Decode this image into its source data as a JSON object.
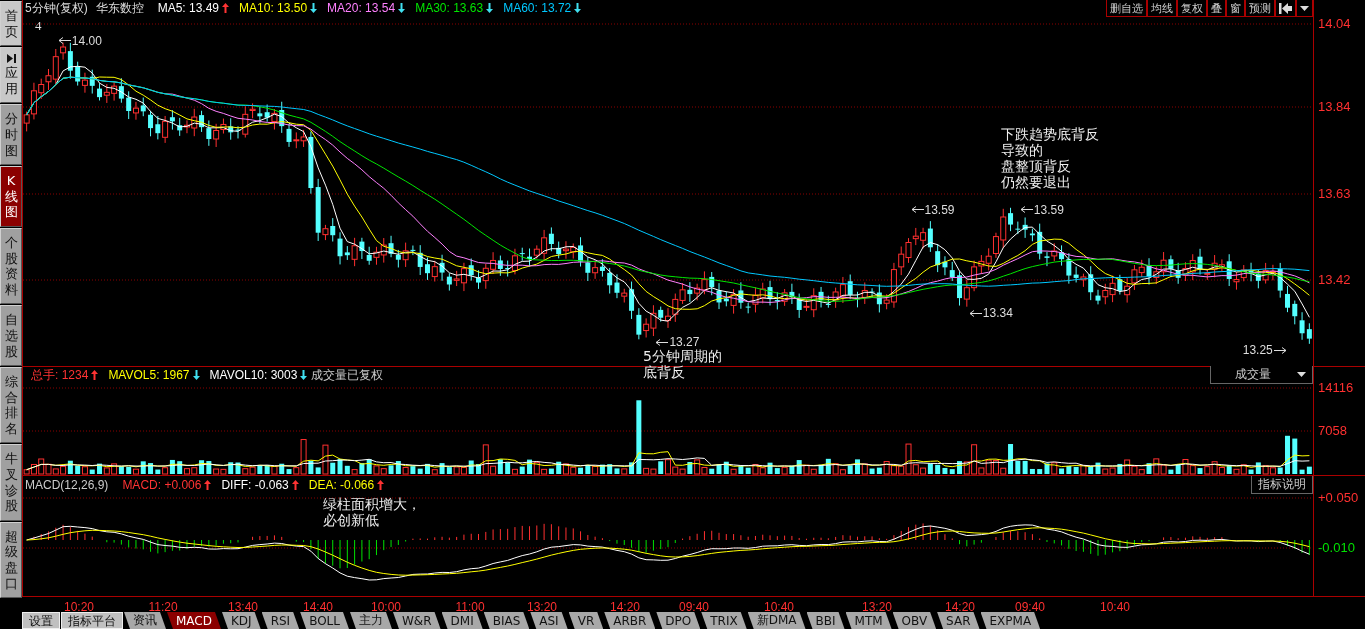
{
  "sidebar": {
    "items": [
      {
        "label": "首页",
        "icon": false,
        "selected": false
      },
      {
        "label": "应用",
        "icon": true,
        "selected": false
      },
      {
        "label": "分时图",
        "icon": false,
        "selected": false
      },
      {
        "label": "K线图",
        "icon": false,
        "selected": true
      },
      {
        "label": "个股资料",
        "icon": false,
        "selected": false
      },
      {
        "label": "自选股",
        "icon": false,
        "selected": false
      },
      {
        "label": "综合排名",
        "icon": false,
        "selected": false
      },
      {
        "label": "牛叉诊股",
        "icon": false,
        "selected": false
      },
      {
        "label": "超级盘口",
        "icon": false,
        "selected": false
      }
    ]
  },
  "price_panel": {
    "period": "5分钟(复权)",
    "stock": "华东数控",
    "legend": [
      {
        "label": "MA5: 13.49",
        "rising": true,
        "color": "#ffffff"
      },
      {
        "label": "MA10: 13.50",
        "rising": false,
        "color": "#ffff00"
      },
      {
        "label": "MA20: 13.54",
        "rising": false,
        "color": "#ff80ff"
      },
      {
        "label": "MA30: 13.63",
        "rising": false,
        "color": "#00e600"
      },
      {
        "label": "MA60: 13.72",
        "rising": false,
        "color": "#00c8ff"
      }
    ],
    "toolbar": [
      "删自选",
      "均线",
      "复权",
      "叠",
      "窗",
      "预测"
    ],
    "axis_labels": [
      "14.04",
      "13.84",
      "13.63",
      "13.42"
    ],
    "corner_mark": "4",
    "price_marks": [
      {
        "text": "14.00",
        "pointer_after": false
      },
      {
        "text": "13.27",
        "pointer_after": false
      },
      {
        "text": "13.59",
        "pointer_after": false
      },
      {
        "text": "13.34",
        "pointer_after": false
      },
      {
        "text": "13.59",
        "pointer_after": false
      },
      {
        "text": "13.25",
        "pointer_after": true
      }
    ],
    "notes": [
      {
        "lines": [
          "5分钟周期的",
          "底背反"
        ]
      },
      {
        "lines": [
          "下跌趋势底背反",
          "导致的",
          "盘整顶背反",
          "仍然要退出"
        ]
      }
    ]
  },
  "volume_panel": {
    "legend": [
      {
        "label": "总手: 1234",
        "rising": true,
        "color": "#ff3333"
      },
      {
        "label": "MAVOL5: 1967",
        "rising": false,
        "color": "#ffff00"
      },
      {
        "label": "MAVOL10: 3003",
        "rising": false,
        "color": "#ffffff"
      }
    ],
    "note": "成交量已复权",
    "selector": "成交量",
    "axis_labels": [
      "14116",
      "7058"
    ]
  },
  "macd_panel": {
    "title": "MACD(12,26,9)",
    "legend": [
      {
        "label": "MACD: +0.006",
        "rising": true,
        "color": "#ff3333"
      },
      {
        "label": "DIFF: -0.063",
        "rising": true,
        "color": "#ffffff"
      },
      {
        "label": "DEA: -0.066",
        "rising": true,
        "color": "#ffff00"
      }
    ],
    "help_button": "指标说明",
    "axis_labels": [
      "+0.050",
      "-0.010"
    ],
    "notes": [
      {
        "lines": [
          "绿柱面积增大，",
          "必创新低"
        ]
      }
    ]
  },
  "time_axis": [
    "10:20",
    "11:20",
    "13:40",
    "14:40",
    "10:00",
    "11:00",
    "13:20",
    "14:20",
    "09:40",
    "10:40",
    "13:20",
    "14:20",
    "09:40",
    "10:40"
  ],
  "bottom_tabs": [
    {
      "label": "设置",
      "kind": "button",
      "selected": false
    },
    {
      "label": "指标平台",
      "kind": "button",
      "selected": false
    },
    {
      "label": "资讯",
      "kind": "tab",
      "selected": false
    },
    {
      "label": "MACD",
      "kind": "tab",
      "selected": true
    },
    {
      "label": "KDJ",
      "kind": "tab",
      "selected": false
    },
    {
      "label": "RSI",
      "kind": "tab",
      "selected": false
    },
    {
      "label": "BOLL",
      "kind": "tab",
      "selected": false
    },
    {
      "label": "主力",
      "kind": "tab",
      "selected": false
    },
    {
      "label": "W&R",
      "kind": "tab",
      "selected": false
    },
    {
      "label": "DMI",
      "kind": "tab",
      "selected": false
    },
    {
      "label": "BIAS",
      "kind": "tab",
      "selected": false
    },
    {
      "label": "ASI",
      "kind": "tab",
      "selected": false
    },
    {
      "label": "VR",
      "kind": "tab",
      "selected": false
    },
    {
      "label": "ARBR",
      "kind": "tab",
      "selected": false
    },
    {
      "label": "DPO",
      "kind": "tab",
      "selected": false
    },
    {
      "label": "TRIX",
      "kind": "tab",
      "selected": false
    },
    {
      "label": "新DMA",
      "kind": "tab",
      "selected": false
    },
    {
      "label": "BBI",
      "kind": "tab",
      "selected": false
    },
    {
      "label": "MTM",
      "kind": "tab",
      "selected": false
    },
    {
      "label": "OBV",
      "kind": "tab",
      "selected": false
    },
    {
      "label": "SAR",
      "kind": "tab",
      "selected": false
    },
    {
      "label": "EXPMA",
      "kind": "tab",
      "selected": false
    }
  ]
}
